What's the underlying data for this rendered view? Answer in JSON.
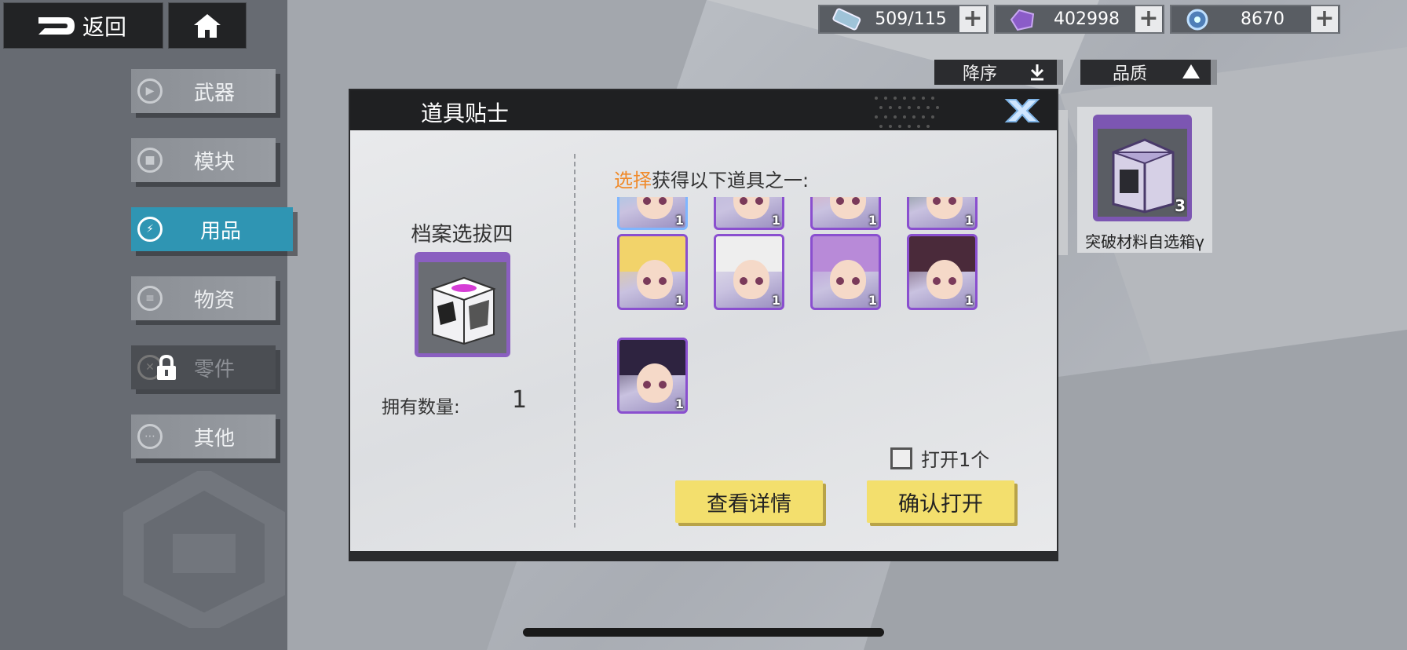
{
  "topbar": {
    "back_label": "返回",
    "resources": [
      {
        "icon": "fuel-icon",
        "value": "509/115"
      },
      {
        "icon": "crystal-icon",
        "value": "402998"
      },
      {
        "icon": "orb-icon",
        "value": "8670"
      }
    ]
  },
  "sidebar": {
    "items": [
      {
        "label": "武器",
        "icon": "gun-icon"
      },
      {
        "label": "模块",
        "icon": "module-icon"
      },
      {
        "label": "用品",
        "icon": "lightning-icon"
      },
      {
        "label": "物资",
        "icon": "supply-icon"
      },
      {
        "label": "零件",
        "icon": "parts-icon"
      },
      {
        "label": "其他",
        "icon": "more-icon"
      }
    ],
    "active_index": 2,
    "locked_index": 4
  },
  "sort": {
    "order_label": "降序",
    "quality_label": "品质"
  },
  "item_card": {
    "count": "3",
    "label": "突破材料自选箱γ"
  },
  "dialog": {
    "title": "道具贴士",
    "box_name": "档案选拔四",
    "own_label": "拥有数量:",
    "own_value": "1",
    "prompt_highlight": "选择",
    "prompt_rest": "获得以下道具之一:",
    "characters": [
      {
        "count": "1",
        "hair": "#7fd0e8"
      },
      {
        "count": "1",
        "hair": "#b9b6d8"
      },
      {
        "count": "1",
        "hair": "#e8a0a8"
      },
      {
        "count": "1",
        "hair": "#3e6a4a"
      },
      {
        "count": "1",
        "hair": "#f2d36a"
      },
      {
        "count": "1",
        "hair": "#eeeeee"
      },
      {
        "count": "1",
        "hair": "#b88ad8"
      },
      {
        "count": "1",
        "hair": "#4a2a3a"
      },
      {
        "count": "1",
        "hair": "#2e2340"
      }
    ],
    "open_one_label": "打开1个",
    "details_button": "查看详情",
    "confirm_button": "确认打开"
  },
  "colors": {
    "accent_blue": "#2f95b3",
    "button_yellow": "#f3df6d",
    "rarity_purple": "#8a4fcf",
    "highlight_orange": "#f08a2a"
  }
}
